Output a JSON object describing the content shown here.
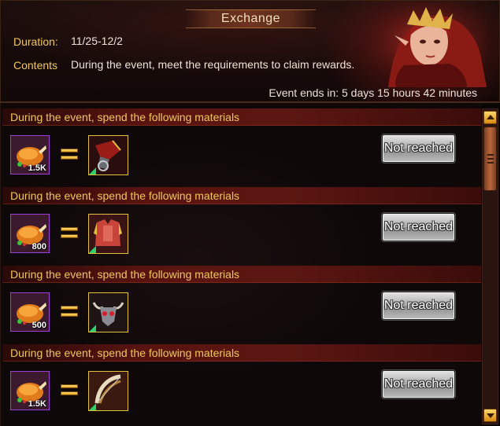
{
  "header": {
    "title": "Exchange",
    "duration_label": "Duration:",
    "duration_value": "11/25-12/2",
    "contents_label": "Contents",
    "contents_value": "During the event, meet the requirements to claim rewards.",
    "event_ends": "Event ends in: 5 days 15 hours 42 minutes"
  },
  "rows": [
    {
      "requirement": "During the event, spend the following materials",
      "cost_icon": "roast-chicken-icon",
      "cost_qty": "1.5K",
      "reward_icon": "red-gauntlet-icon",
      "status": "Not reached"
    },
    {
      "requirement": "During the event, spend the following materials",
      "cost_icon": "roast-chicken-icon",
      "cost_qty": "800",
      "reward_icon": "crimson-armor-icon",
      "status": "Not reached"
    },
    {
      "requirement": "During the event, spend the following materials",
      "cost_icon": "roast-chicken-icon",
      "cost_qty": "500",
      "reward_icon": "bull-skull-helm-icon",
      "status": "Not reached"
    },
    {
      "requirement": "During the event, spend the following materials",
      "cost_icon": "roast-chicken-icon",
      "cost_qty": "1.5K",
      "reward_icon": "horn-bow-icon",
      "status": "Not reached"
    }
  ],
  "colors": {
    "gold_text": "#f0c75a",
    "row_band": "#5a1410",
    "cost_border": "#9b3fd6",
    "reward_border": "#e3c040"
  }
}
